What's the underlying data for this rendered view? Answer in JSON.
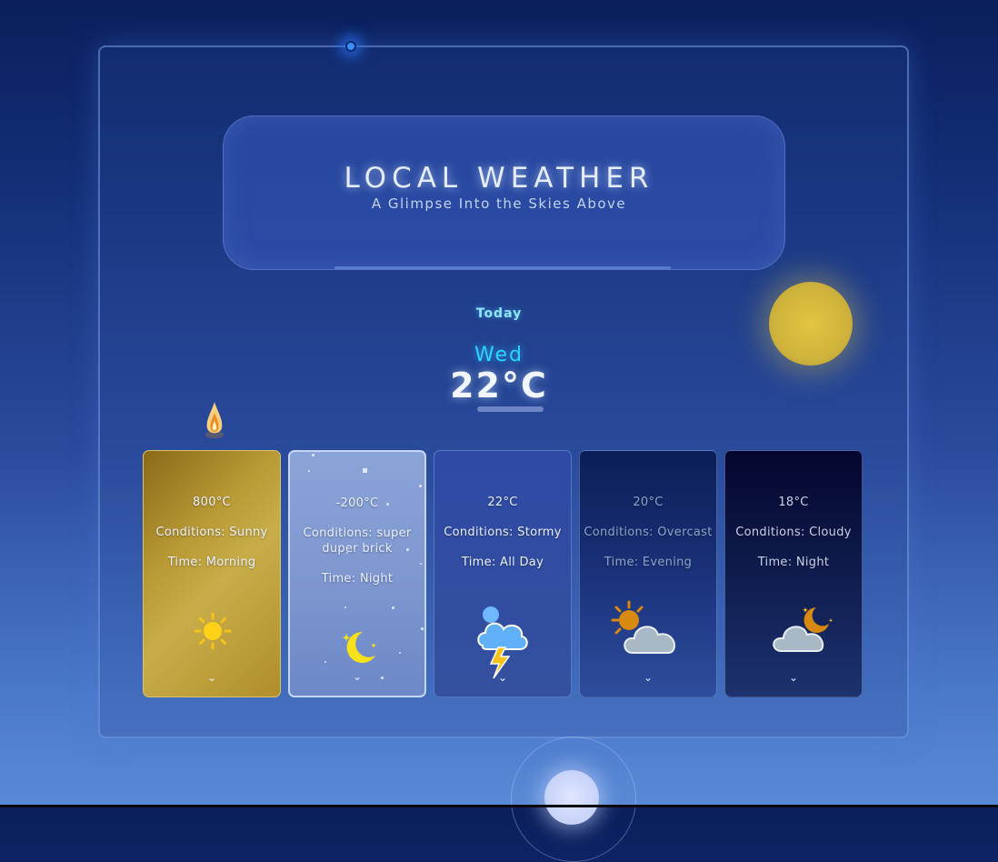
{
  "header": {
    "title": "LOCAL WEATHER",
    "subtitle": "A Glimpse Into the Skies Above"
  },
  "today": {
    "label": "Today",
    "day": "Wed",
    "temperature": "22°C"
  },
  "cards": [
    {
      "temp": "800°C",
      "conditions": "Conditions: Sunny",
      "time": "Time: Morning",
      "icon": "sun-icon"
    },
    {
      "temp": "-200°C",
      "conditions": "Conditions: super duper brick",
      "time": "Time: Night",
      "icon": "moon-icon"
    },
    {
      "temp": "22°C",
      "conditions": "Conditions: Stormy",
      "time": "Time: All Day",
      "icon": "storm-cloud-icon"
    },
    {
      "temp": "20°C",
      "conditions": "Conditions: Overcast",
      "time": "Time: Evening",
      "icon": "sun-cloud-icon"
    },
    {
      "temp": "18°C",
      "conditions": "Conditions: Cloudy",
      "time": "Time: Night",
      "icon": "moon-cloud-icon"
    }
  ],
  "colors": {
    "accent": "#2ad6ff",
    "sunny_card": "#b99a35",
    "sun_orb": "#d0b33c"
  }
}
